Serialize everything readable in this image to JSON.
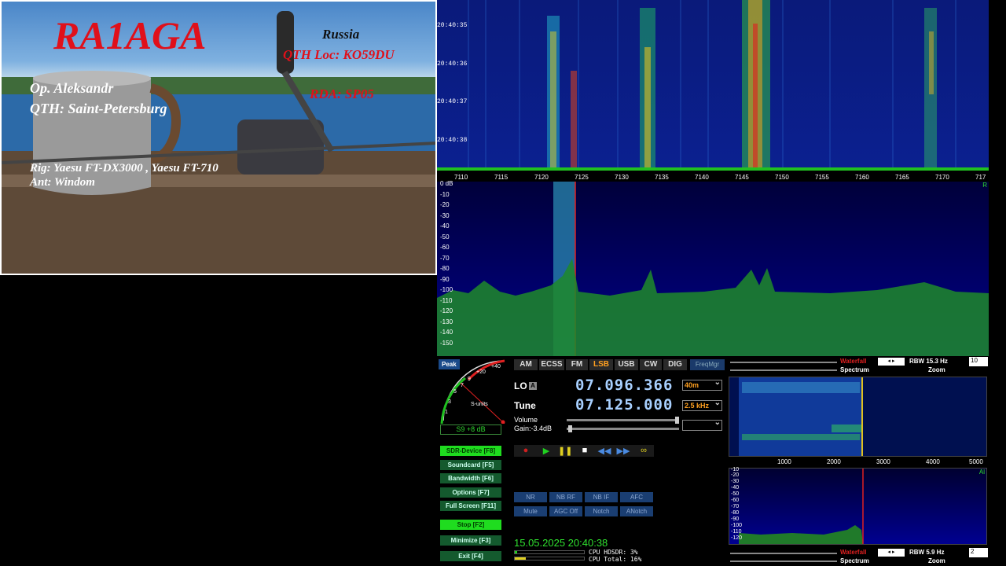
{
  "station": {
    "callsign": "RA1AGA",
    "country": "Russia",
    "qth_loc": "QTH Loc: KO59DU",
    "rda": "RDA: SP05",
    "operator": "Op. Aleksandr",
    "qth": "QTH: Saint-Petersburg",
    "rig": "Rig: Yaesu FT-DX3000 , Yaesu FT-710",
    "antenna": "Ant: Windom"
  },
  "waterfall": {
    "time_labels": [
      "20:40:35",
      "20:40:36",
      "20:40:37",
      "20:40:38"
    ],
    "freq_labels": [
      "7110",
      "7115",
      "7120",
      "7125",
      "7130",
      "7135",
      "7140",
      "7145",
      "7150",
      "7155",
      "7160",
      "7165",
      "7170",
      "717"
    ]
  },
  "spectrum": {
    "db_labels": [
      "0 dB",
      "-10",
      "-20",
      "-30",
      "-40",
      "-50",
      "-60",
      "-70",
      "-80",
      "-90",
      "-100",
      "-110",
      "-120",
      "-130",
      "-140",
      "-150"
    ],
    "corner_label": "R"
  },
  "smeter": {
    "peak_label": "Peak",
    "scale_labels": [
      "1",
      "3",
      "5",
      "7",
      "9",
      "+20",
      "+40"
    ],
    "units_label": "S-units",
    "reading": "S9 +8 dB"
  },
  "modes": {
    "buttons": [
      "AM",
      "ECSS",
      "FM",
      "LSB",
      "USB",
      "CW",
      "DIG"
    ],
    "selected": "LSB",
    "freqmgr": "FreqMgr"
  },
  "lo": {
    "label": "LO",
    "badge": "A",
    "value": "07.096.366",
    "band": "40m"
  },
  "tune": {
    "label": "Tune",
    "value": "07.125.000",
    "bandwidth": "2.5 kHz"
  },
  "volume": {
    "label": "Volume",
    "gain": "Gain:-3.4dB"
  },
  "side_buttons": [
    {
      "label": "SDR-Device [F8]",
      "on": true
    },
    {
      "label": "Soundcard [F5]",
      "on": false
    },
    {
      "label": "Bandwidth [F6]",
      "on": false
    },
    {
      "label": "Options [F7]",
      "on": false
    },
    {
      "label": "Full Screen [F11]",
      "on": false
    },
    {
      "label": "Stop [F2]",
      "on": true
    },
    {
      "label": "Minimize [F3]",
      "on": false
    },
    {
      "label": "Exit [F4]",
      "on": false
    }
  ],
  "dsp": {
    "row1": [
      "NR",
      "NB RF",
      "NB IF",
      "AFC"
    ],
    "row2": [
      "Mute",
      "AGC Off",
      "Notch",
      "ANotch"
    ]
  },
  "status": {
    "datetime": "15.05.2025 20:40:38",
    "cpu_hdsdr": "CPU HDSDR: 3%",
    "cpu_total": "CPU Total: 16%"
  },
  "mini": {
    "top": {
      "waterfall": "Waterfall",
      "spectrum": "Spectrum",
      "zoom": "Zoom",
      "rbw": "RBW 15.3 Hz",
      "value": "10"
    },
    "bottom": {
      "waterfall": "Waterfall",
      "spectrum": "Spectrum",
      "zoom": "Zoom",
      "rbw": "RBW 5.9 Hz",
      "value": "2"
    },
    "freq_labels": [
      "1000",
      "2000",
      "3000",
      "4000",
      "5000"
    ],
    "db_labels": [
      "-10",
      "-20",
      "-30",
      "-40",
      "-50",
      "-60",
      "-70",
      "-80",
      "-90",
      "-100",
      "-110",
      "-120"
    ],
    "corner_label": "Al"
  },
  "colors": {
    "callsign": "#e0101a",
    "freq_display": "#a8d0ff",
    "active_button": "#1fdc1f",
    "selected_mode": "#ffa020",
    "clock": "#2fe02f"
  }
}
